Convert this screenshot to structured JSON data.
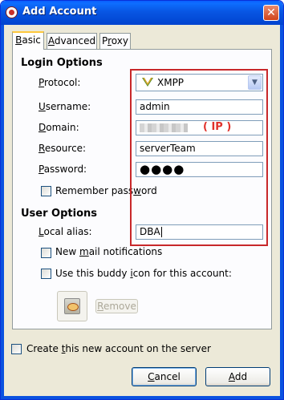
{
  "window": {
    "title": "Add Account",
    "close_glyph": "✕"
  },
  "tabs": [
    {
      "pre": "",
      "mn": "B",
      "post": "asic",
      "active": true
    },
    {
      "pre": "",
      "mn": "A",
      "post": "dvanced",
      "active": false
    },
    {
      "pre": "P",
      "mn": "r",
      "post": "oxy",
      "active": false
    }
  ],
  "login": {
    "title": "Login Options",
    "protocol": {
      "pre": "",
      "mn": "P",
      "post": "rotocol:",
      "value": "XMPP",
      "icon": "xmpp-icon"
    },
    "username": {
      "pre": "",
      "mn": "U",
      "post": "sername:",
      "value": "admin"
    },
    "domain": {
      "pre": "",
      "mn": "D",
      "post": "omain:",
      "value": ""
    },
    "resource": {
      "pre": "",
      "mn": "R",
      "post": "esource:",
      "value": "serverTeam"
    },
    "password": {
      "pre": "",
      "mn": "P",
      "post": "assword:",
      "value": "●●●●"
    },
    "remember": {
      "pre": "Remember pass",
      "mn": "w",
      "post": "ord",
      "checked": false
    }
  },
  "annotation": {
    "ip": "( IP )",
    "color": "#e0302a"
  },
  "user": {
    "title": "User Options",
    "alias": {
      "pre": "",
      "mn": "L",
      "post": "ocal alias:",
      "value": "DBA"
    },
    "new_mail": {
      "pre": "New ",
      "mn": "m",
      "post": "ail notifications",
      "checked": false
    },
    "buddy": {
      "pre": "Use this buddy ",
      "mn": "i",
      "post": "con for this account:",
      "checked": false
    },
    "remove": {
      "pre": "",
      "mn": "R",
      "post": "emove"
    }
  },
  "create": {
    "pre": "Create ",
    "mn": "t",
    "post": "his new account on the server",
    "checked": false
  },
  "buttons": {
    "cancel": {
      "pre": "",
      "mn": "C",
      "post": "ancel"
    },
    "add": {
      "pre": "",
      "mn": "A",
      "post": "dd"
    }
  },
  "colors": {
    "titlebar": "#0856e3",
    "highlight_box": "#c8282a"
  }
}
